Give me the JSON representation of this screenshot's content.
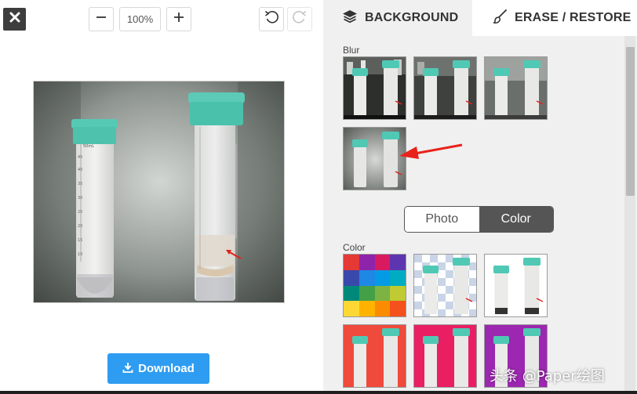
{
  "toolbar": {
    "zoom_level": "100%",
    "close_icon": "close-x-icon",
    "zoom_out_icon": "minus-icon",
    "zoom_in_icon": "plus-icon",
    "undo_icon": "undo-icon",
    "redo_icon": "redo-icon"
  },
  "download": {
    "label": "Download",
    "icon": "download-icon"
  },
  "tabs": [
    {
      "label": "BACKGROUND",
      "icon": "layers-icon",
      "selected": false
    },
    {
      "label": "ERASE / RESTORE",
      "icon": "brush-icon",
      "selected": true
    }
  ],
  "blur_section": {
    "label": "Blur",
    "levels": [
      "no-blur",
      "light-blur",
      "medium-blur",
      "strong-blur"
    ]
  },
  "mode_toggle": {
    "options": [
      "Photo",
      "Color"
    ],
    "selected": "Color"
  },
  "color_section": {
    "label": "Color",
    "swatch_palette": [
      "#e53935",
      "#8e24aa",
      "#d81b60",
      "#5e35b1",
      "#3949ab",
      "#1e88e5",
      "#039be5",
      "#00acc1",
      "#00897b",
      "#43a047",
      "#7cb342",
      "#c0ca33",
      "#fdd835",
      "#ffb300",
      "#fb8c00",
      "#f4511e"
    ],
    "backgrounds": [
      "palette",
      "transparent",
      "white",
      "red",
      "pink",
      "purple"
    ],
    "background_colors": {
      "red": "#ef4a3c",
      "pink": "#e91e63",
      "purple": "#9c27b0",
      "white": "#ffffff"
    }
  },
  "watermark": "头条 @Paper绘图",
  "colors": {
    "accent": "#2e9cf1",
    "cap_teal": "#4fc9b4",
    "close_bg": "#3d3d3d"
  }
}
